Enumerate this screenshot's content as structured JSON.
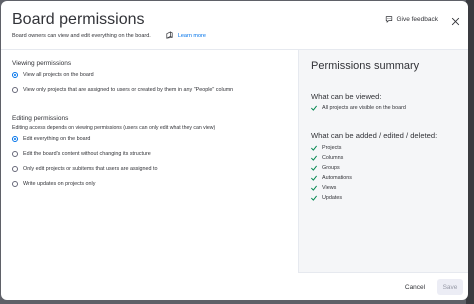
{
  "dialog": {
    "title": "Board permissions",
    "subtitle": "Board owners can view and edit everything on the board.",
    "learn_more": "Learn more",
    "feedback_label": "Give feedback"
  },
  "viewing": {
    "title": "Viewing permissions",
    "options": [
      {
        "label": "View all projects on the board",
        "checked": true
      },
      {
        "label": "View only projects that are assigned to users or created by them in any \"People\" column",
        "checked": false
      }
    ]
  },
  "editing": {
    "title": "Editing permissions",
    "description": "Editing access depends on viewing permissions (users can only edit what they can view)",
    "options": [
      {
        "label": "Edit everything on the board",
        "checked": true
      },
      {
        "label": "Edit the board's content without changing its structure",
        "checked": false
      },
      {
        "label": "Only edit projects or subitems that users are assigned to",
        "checked": false
      },
      {
        "label": "Write updates on projects only",
        "checked": false
      }
    ]
  },
  "summary": {
    "title": "Permissions summary",
    "viewed_heading": "What can be viewed:",
    "viewed_items": [
      "All projects are visible on the board"
    ],
    "edited_heading": "What can be added / edited / deleted:",
    "edited_items": [
      "Projects",
      "Columns",
      "Groups",
      "Automations",
      "Views",
      "Updates"
    ]
  },
  "footer": {
    "cancel_label": "Cancel",
    "save_label": "Save"
  },
  "colors": {
    "accent": "#0073ea",
    "check": "#00854d",
    "text": "#323338"
  },
  "icons": {
    "learn_more": "book-icon",
    "feedback": "feedback-icon",
    "close": "close-icon",
    "check": "check-icon"
  }
}
